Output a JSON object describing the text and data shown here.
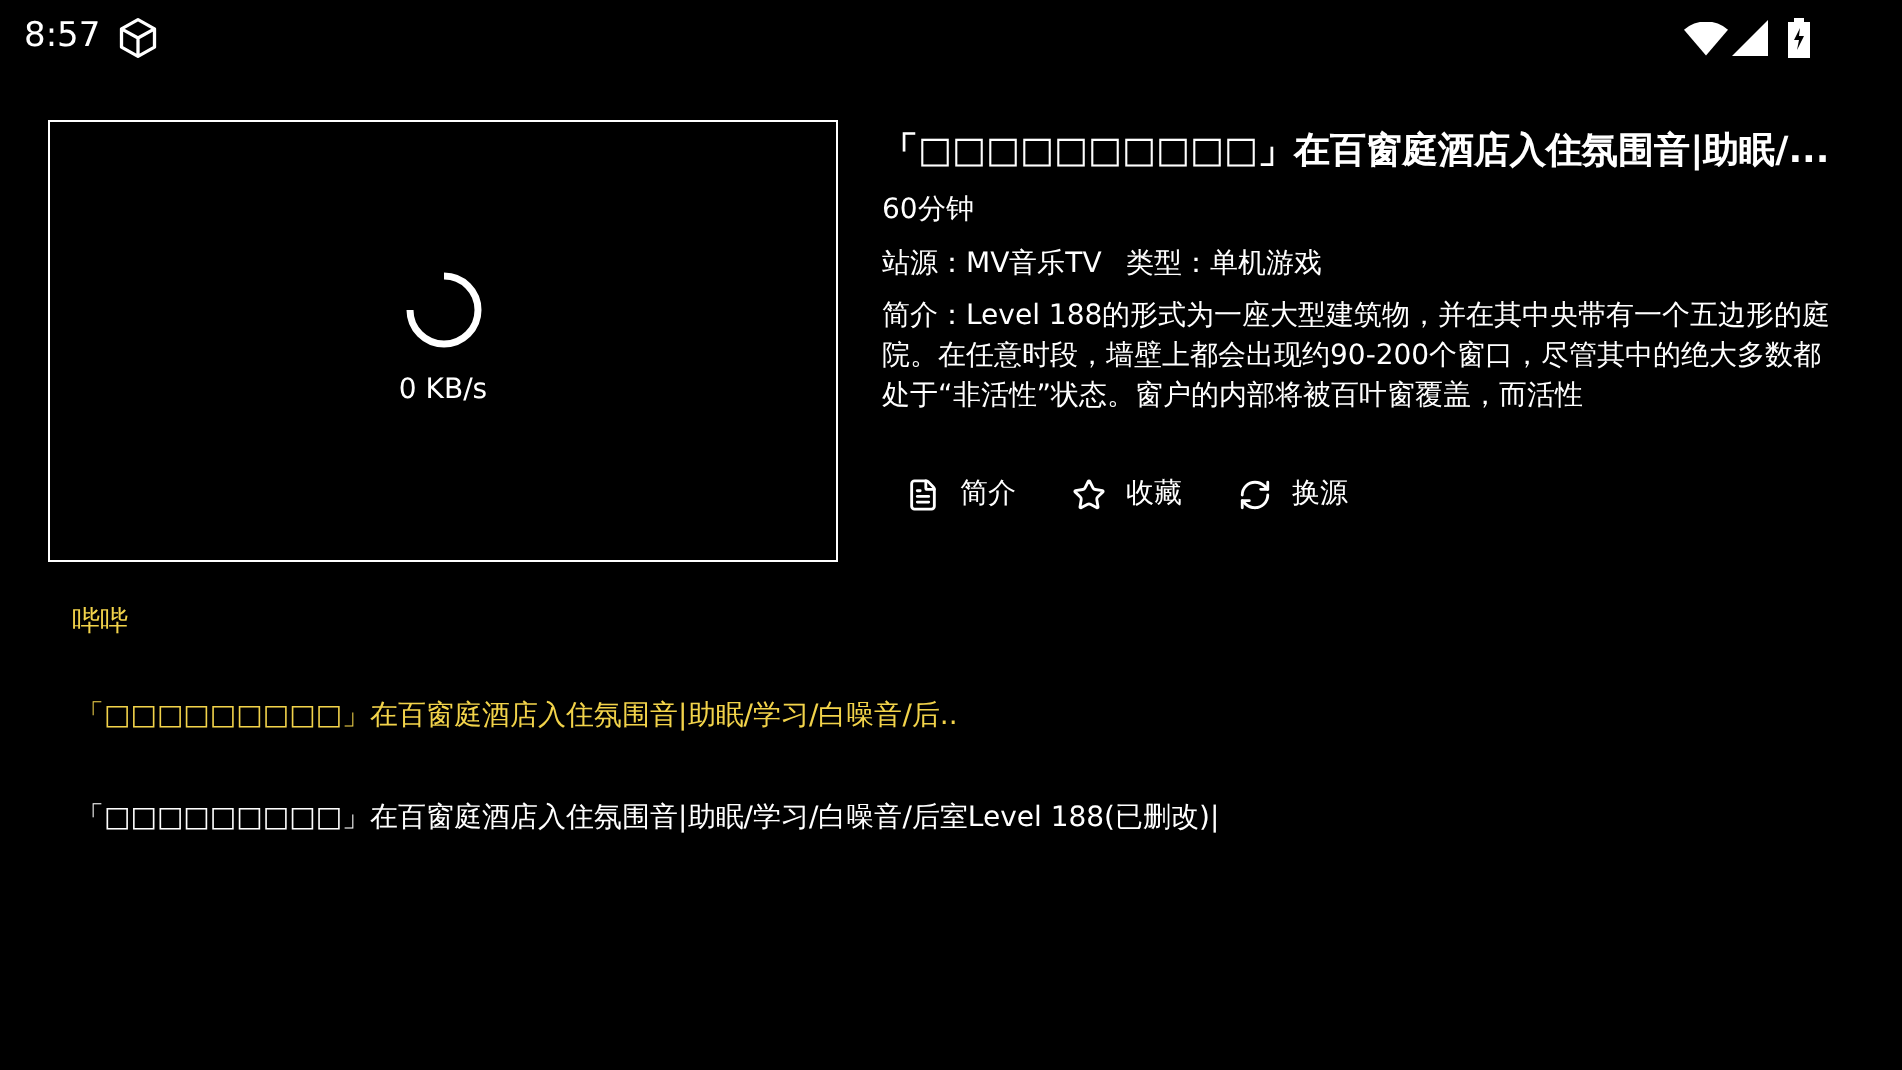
{
  "status_bar": {
    "time": "8:57"
  },
  "player": {
    "speed": "0 KB/s"
  },
  "detail": {
    "title": "「□□□□□□□□□□」在百窗庭酒店入住氛围音|助眠/...",
    "duration": "60分钟",
    "source": "站源：MV音乐TV",
    "genre": "类型：单机游戏",
    "summary": "简介：Level 188的形式为一座大型建筑物，并在其中央带有一个五边形的庭院。在任意时段，墙壁上都会出现约90-200个窗口，尽管其中的绝大多数都处于“非活性”状态。窗户的内部将被百叶窗覆盖，而活性"
  },
  "actions": [
    {
      "kind": "info",
      "label": "简介"
    },
    {
      "kind": "favorite",
      "label": "收藏"
    },
    {
      "kind": "switch",
      "label": "换源"
    }
  ],
  "sources": [
    {
      "label": "哔哔",
      "selected": true
    }
  ],
  "episodes": [
    {
      "label": "「□□□□□□□□□」在百窗庭酒店入住氛围音|助眠/学习/白噪音/后..",
      "selected": true
    },
    {
      "label": "「□□□□□□□□□」在百窗庭酒店入住氛围音|助眠/学习/白噪音/后室Level 188(已删改)|",
      "selected": false
    }
  ]
}
